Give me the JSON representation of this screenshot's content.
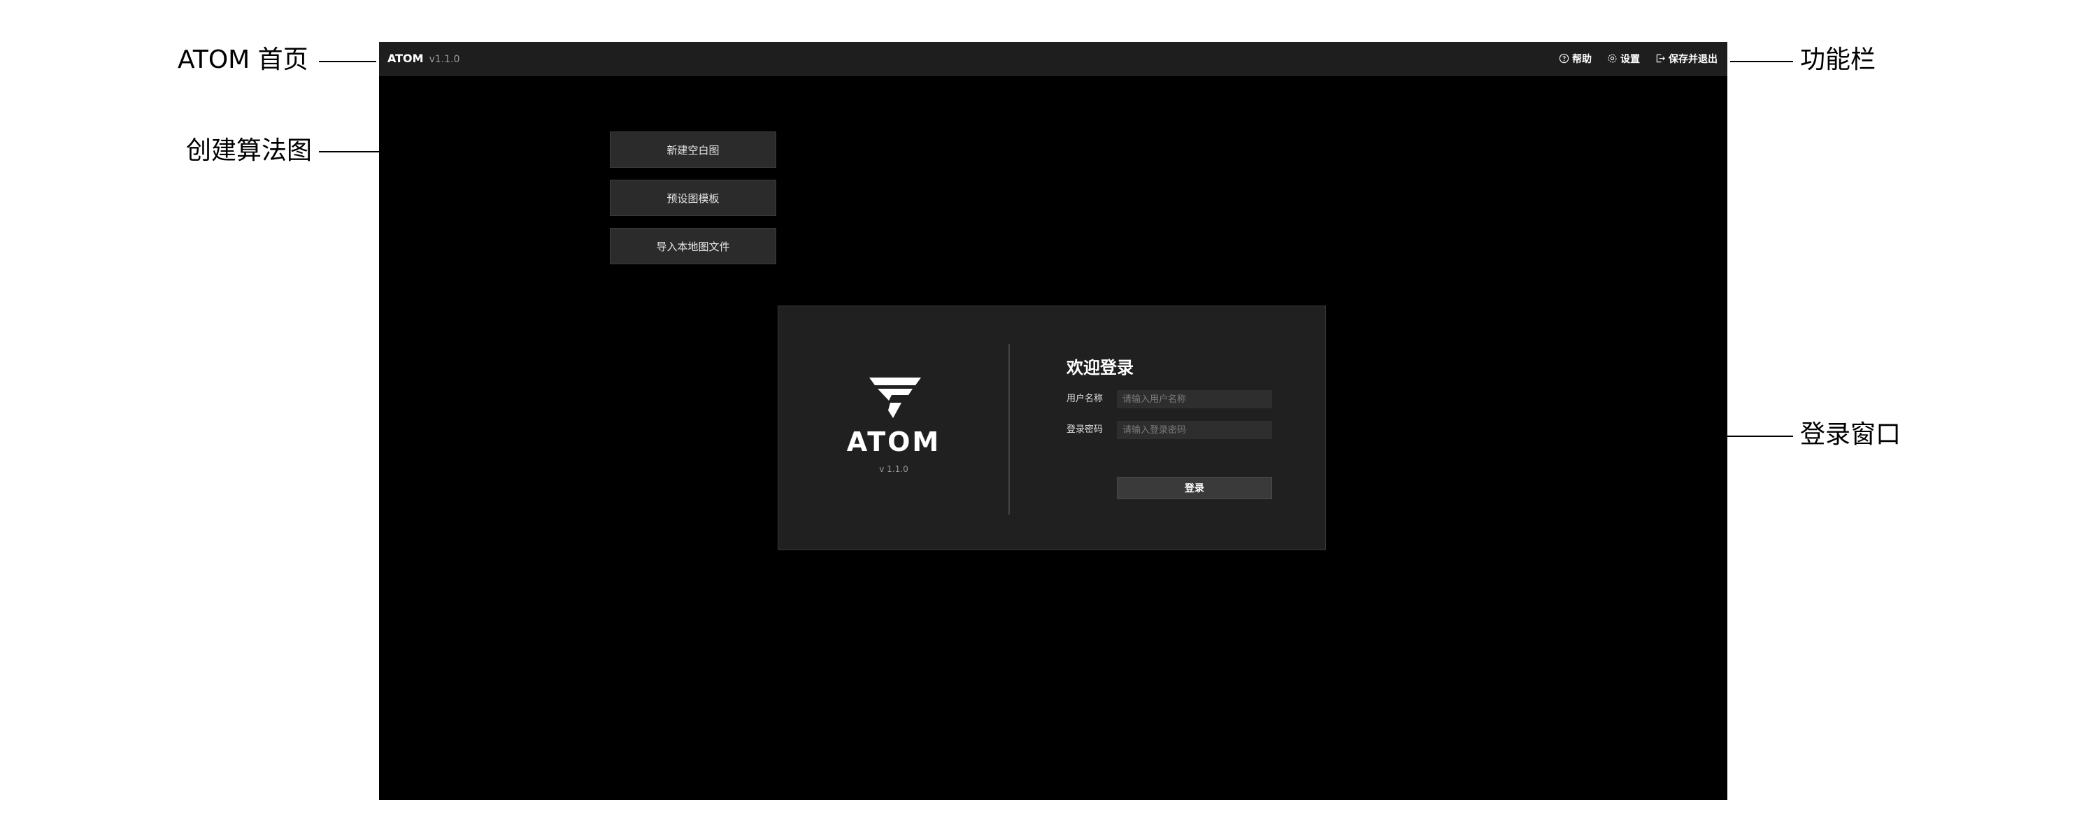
{
  "annotations": {
    "home": "ATOM 首页",
    "create": "创建算法图",
    "toolbar": "功能栏",
    "login": "登录窗口"
  },
  "app": {
    "name": "ATOM",
    "version": "v1.1.0"
  },
  "toolbar": {
    "help": {
      "label": "帮助",
      "icon": "help-icon"
    },
    "settings": {
      "label": "设置",
      "icon": "gear-icon"
    },
    "save_exit": {
      "label": "保存并退出",
      "icon": "exit-icon"
    }
  },
  "create_buttons": [
    {
      "label": "新建空白图"
    },
    {
      "label": "预设图模板"
    },
    {
      "label": "导入本地图文件"
    }
  ],
  "login": {
    "logo_name": "ATOM",
    "logo_version": "v 1.1.0",
    "title": "欢迎登录",
    "username_label": "用户名称",
    "username_placeholder": "请输入用户名称",
    "password_label": "登录密码",
    "password_placeholder": "请输入登录密码",
    "submit_label": "登录"
  },
  "colors": {
    "app_bg": "#000000",
    "topbar_bg": "#1e1e1e",
    "panel_bg": "#202020",
    "button_bg": "#2b2b2b",
    "text": "#ffffff"
  }
}
